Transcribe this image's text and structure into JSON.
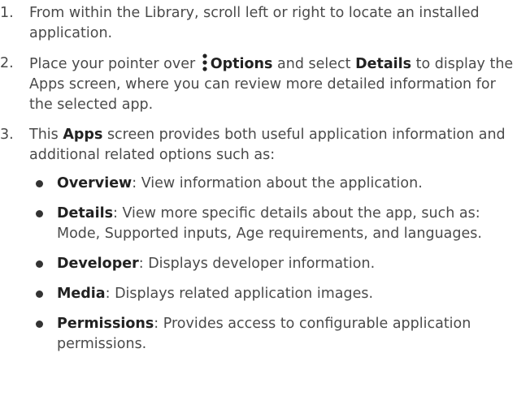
{
  "steps": [
    {
      "number": "1.",
      "text": "From within the Library, scroll left or right to locate an installed application."
    },
    {
      "number": "2.",
      "text_before": "Place your pointer over",
      "options_label": "Options",
      "text_middle": "and select",
      "details_label": "Details",
      "text_after": "to display the Apps screen, where you can review more detailed information for the selected app.",
      "icon": "kebab-vertical-dots-icon"
    },
    {
      "number": "3.",
      "text_before": "This",
      "apps_label": "Apps",
      "text_after": "screen provides both useful application information and additional related options such as:",
      "options": [
        {
          "label": "Overview",
          "description": ": View information about the application."
        },
        {
          "label": "Details",
          "description": ": View more specific details about the app, such as: Mode, Supported inputs, Age requirements, and languages."
        },
        {
          "label": "Developer",
          "description": ": Displays developer information."
        },
        {
          "label": "Media",
          "description": ": Displays related application images."
        },
        {
          "label": "Permissions",
          "description": ": Provides access to configurable application permissions."
        }
      ]
    }
  ]
}
